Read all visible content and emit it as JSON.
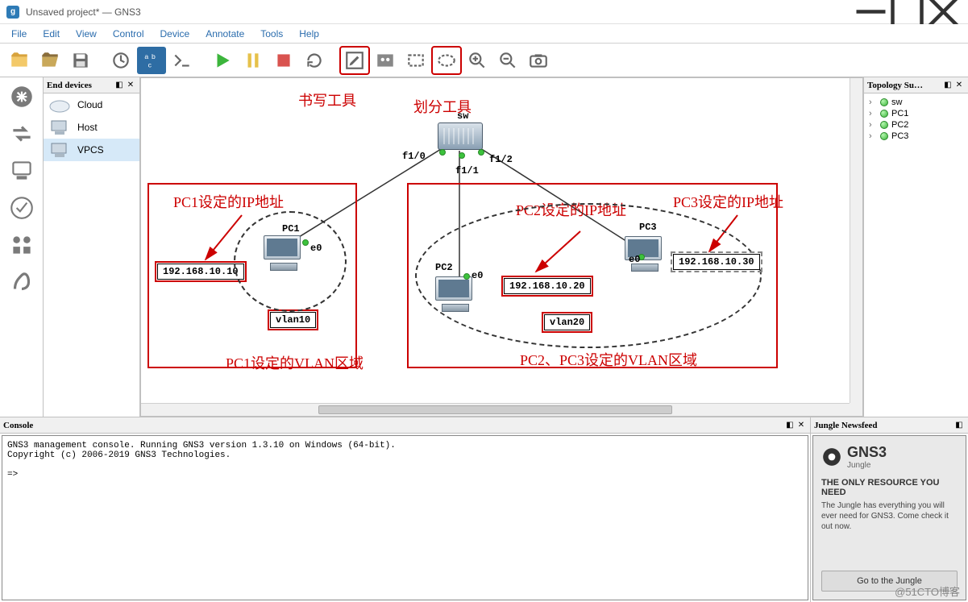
{
  "window": {
    "title": "Unsaved project* — GNS3",
    "app_initial": "g"
  },
  "menu": [
    "File",
    "Edit",
    "View",
    "Control",
    "Device",
    "Annotate",
    "Tools",
    "Help"
  ],
  "annotations": {
    "write_tool": "书写工具",
    "split_tool": "划分工具",
    "pc1_ip_label": "PC1设定的IP地址",
    "pc2_ip_label": "PC2设定的IP地址",
    "pc3_ip_label": "PC3设定的IP地址",
    "pc1_vlan_label": "PC1设定的VLAN区域",
    "pc23_vlan_label": "PC2、PC3设定的VLAN区域"
  },
  "panels": {
    "end_devices_title": "End devices",
    "topology_title": "Topology Su…",
    "console_title": "Console",
    "jungle_title": "Jungle Newsfeed"
  },
  "end_devices": [
    {
      "label": "Cloud",
      "icon": "cloud"
    },
    {
      "label": "Host",
      "icon": "host"
    },
    {
      "label": "VPCS",
      "icon": "vpcs"
    }
  ],
  "topology": [
    "sw",
    "PC1",
    "PC2",
    "PC3"
  ],
  "canvas": {
    "sw_label": "sw",
    "ports": {
      "f10": "f1/0",
      "f11": "f1/1",
      "f12": "f1/2"
    },
    "pc1": {
      "name": "PC1",
      "port": "e0",
      "ip": "192.168.10.10"
    },
    "pc2": {
      "name": "PC2",
      "port": "e0",
      "ip": "192.168.10.20"
    },
    "pc3": {
      "name": "PC3",
      "port": "e0",
      "ip": "192.168.10.30"
    },
    "vlan10": "vlan10",
    "vlan20": "vlan20"
  },
  "console": {
    "line1": "GNS3 management console. Running GNS3 version 1.3.10 on Windows (64-bit).",
    "line2": "Copyright (c) 2006-2019 GNS3 Technologies.",
    "prompt": "=>"
  },
  "jungle": {
    "brand": "GNS3",
    "sub": "Jungle",
    "headline": "THE ONLY RESOURCE YOU NEED",
    "text": "The Jungle has everything you will ever need for GNS3. Come check it out now.",
    "button": "Go to the Jungle"
  },
  "watermark": "@51CTO博客"
}
